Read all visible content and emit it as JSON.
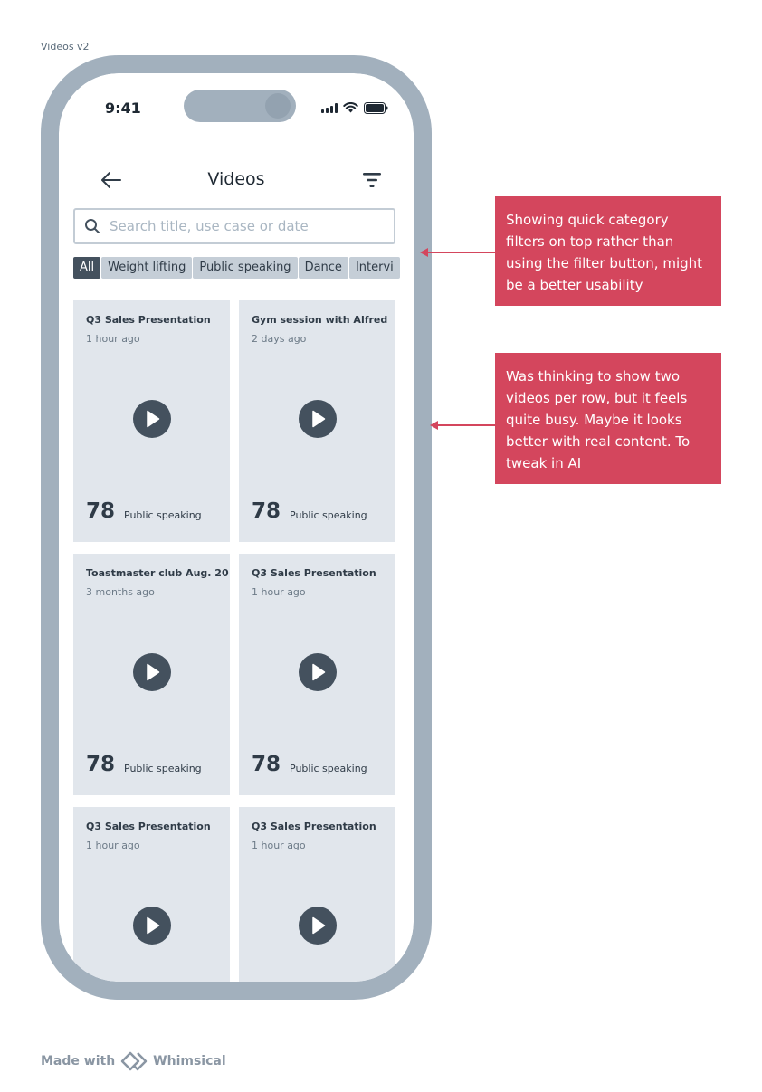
{
  "frame_label": "Videos v2",
  "status_bar": {
    "time": "9:41"
  },
  "header": {
    "title": "Videos"
  },
  "search": {
    "placeholder": "Search title, use case or date",
    "value": ""
  },
  "chips": [
    {
      "label": "All",
      "active": true
    },
    {
      "label": "Weight lifting",
      "active": false
    },
    {
      "label": "Public speaking",
      "active": false
    },
    {
      "label": "Dance",
      "active": false
    },
    {
      "label": "Intervi",
      "active": false
    }
  ],
  "videos": [
    {
      "title": "Q3 Sales Presentation",
      "time": "1 hour ago",
      "score": "78",
      "category": "Public speaking"
    },
    {
      "title": "Gym session with Alfred",
      "time": "2 days ago",
      "score": "78",
      "category": "Public speaking"
    },
    {
      "title": "Toastmaster club Aug. 20",
      "time": "3 months ago",
      "score": "78",
      "category": "Public speaking"
    },
    {
      "title": "Q3 Sales Presentation",
      "time": "1 hour ago",
      "score": "78",
      "category": "Public speaking"
    },
    {
      "title": "Q3 Sales Presentation",
      "time": "1 hour ago",
      "score": "",
      "category": ""
    },
    {
      "title": "Q3 Sales Presentation",
      "time": "1 hour ago",
      "score": "",
      "category": ""
    }
  ],
  "notes": [
    {
      "text": "Showing quick category filters on top rather than using the filter button, might be a better usability"
    },
    {
      "text": "Was thinking to show two videos per row, but it feels quite busy. Maybe it looks better with real content. To tweak in AI"
    }
  ],
  "footer": {
    "made_with": "Made with",
    "brand": "Whimsical"
  },
  "colors": {
    "accent": "#d4465d",
    "phone_frame": "#a2b0bd",
    "card_bg": "#e1e6ec",
    "dark": "#44515e"
  }
}
